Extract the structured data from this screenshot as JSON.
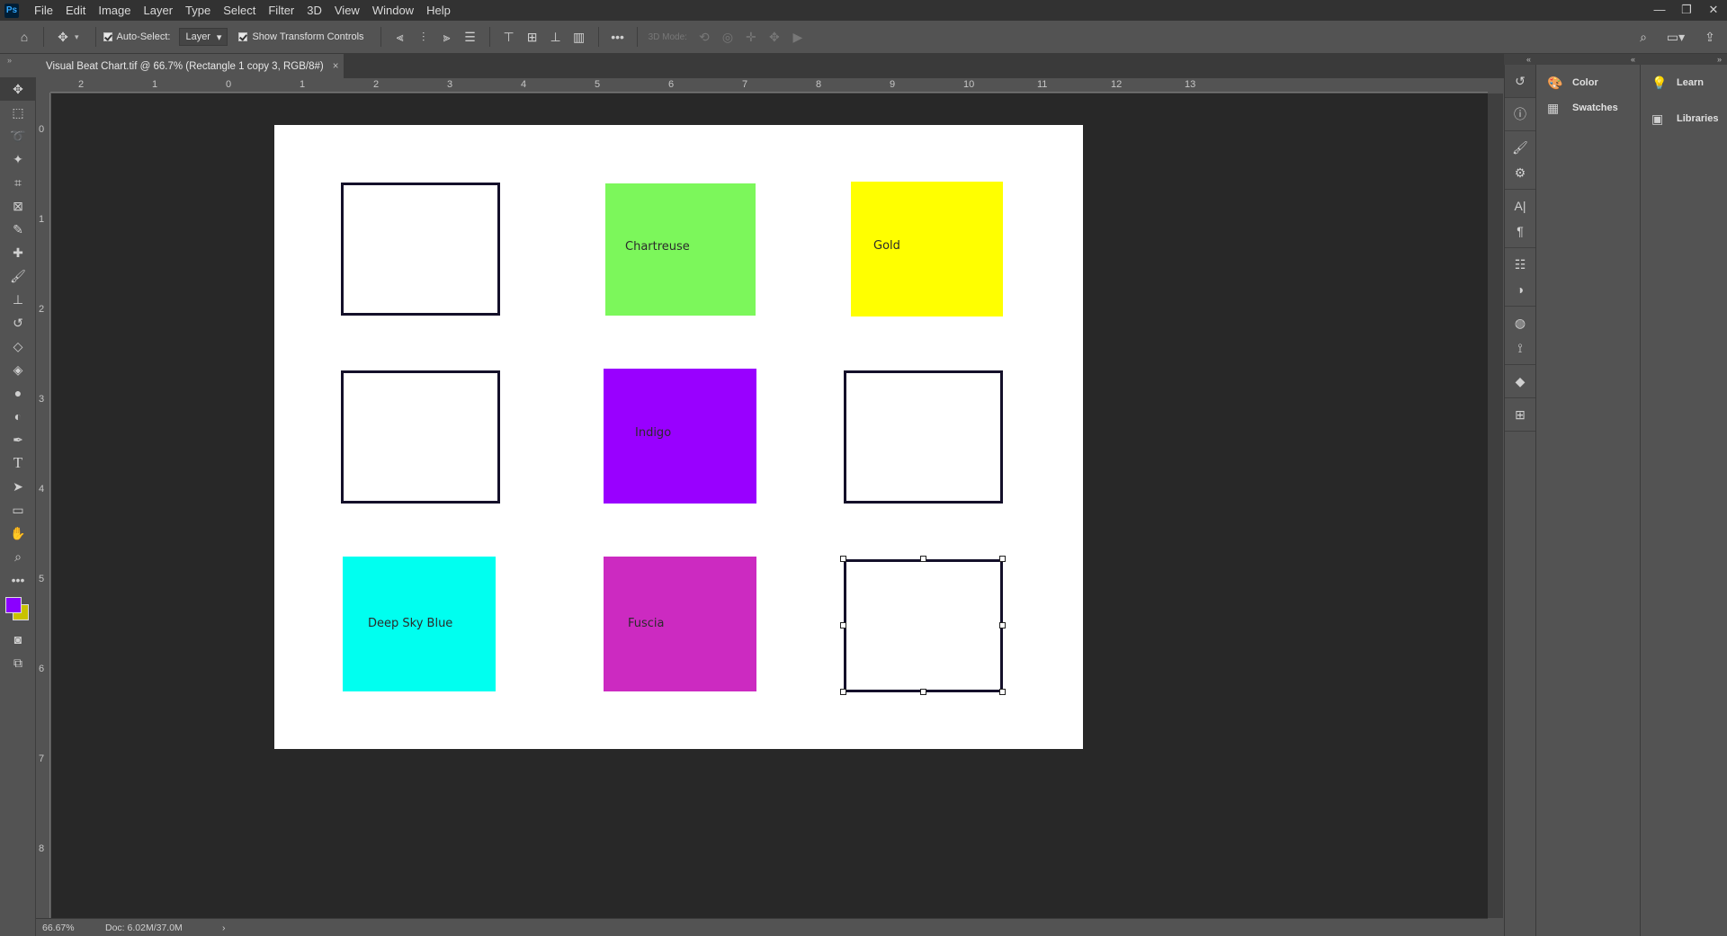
{
  "app": {
    "logo": "Ps"
  },
  "menu": [
    "File",
    "Edit",
    "Image",
    "Layer",
    "Type",
    "Select",
    "Filter",
    "3D",
    "View",
    "Window",
    "Help"
  ],
  "options": {
    "auto_select_label": "Auto-Select:",
    "auto_select_value": "Layer",
    "show_transform_label": "Show Transform Controls",
    "mode_3d_label": "3D Mode:"
  },
  "document": {
    "tab_title": "Visual Beat Chart.tif @ 66.7% (Rectangle 1 copy 3, RGB/8#)",
    "close": "×"
  },
  "rulers": {
    "horizontal": [
      "2",
      "1",
      "0",
      "1",
      "2",
      "3",
      "4",
      "5",
      "6",
      "7",
      "8",
      "9",
      "10",
      "11",
      "12",
      "13"
    ],
    "vertical": [
      "0",
      "1",
      "2",
      "3",
      "4",
      "5",
      "6",
      "7",
      "8"
    ]
  },
  "swatches": [
    {
      "label": "",
      "color": "#ffffff",
      "style": "outline"
    },
    {
      "label": "Chartreuse",
      "color": "#7cf75b",
      "style": "filled"
    },
    {
      "label": "Gold",
      "color": "#ffff00",
      "style": "filled"
    },
    {
      "label": "",
      "color": "#ffffff",
      "style": "outline"
    },
    {
      "label": "Indigo",
      "color": "#9900ff",
      "style": "filled"
    },
    {
      "label": "",
      "color": "#ffffff",
      "style": "outline"
    },
    {
      "label": "Deep Sky Blue",
      "color": "#00fff0",
      "style": "filled"
    },
    {
      "label": "Fuscia",
      "color": "#cc2ac1",
      "style": "filled"
    },
    {
      "label": "",
      "color": "#ffffff",
      "style": "outline-selected"
    }
  ],
  "colors": {
    "foreground": "#8b00ff",
    "background": "#c9c200"
  },
  "status": {
    "zoom": "66.67%",
    "doc": "Doc: 6.02M/37.0M",
    "arrow": "›"
  },
  "panels": {
    "col1": [
      {
        "label": "Color",
        "icon": "palette-icon"
      },
      {
        "label": "Swatches",
        "icon": "grid-icon"
      }
    ],
    "col2": [
      {
        "label": "Learn",
        "icon": "lightbulb-icon"
      },
      {
        "label": "Libraries",
        "icon": "library-icon"
      }
    ]
  }
}
